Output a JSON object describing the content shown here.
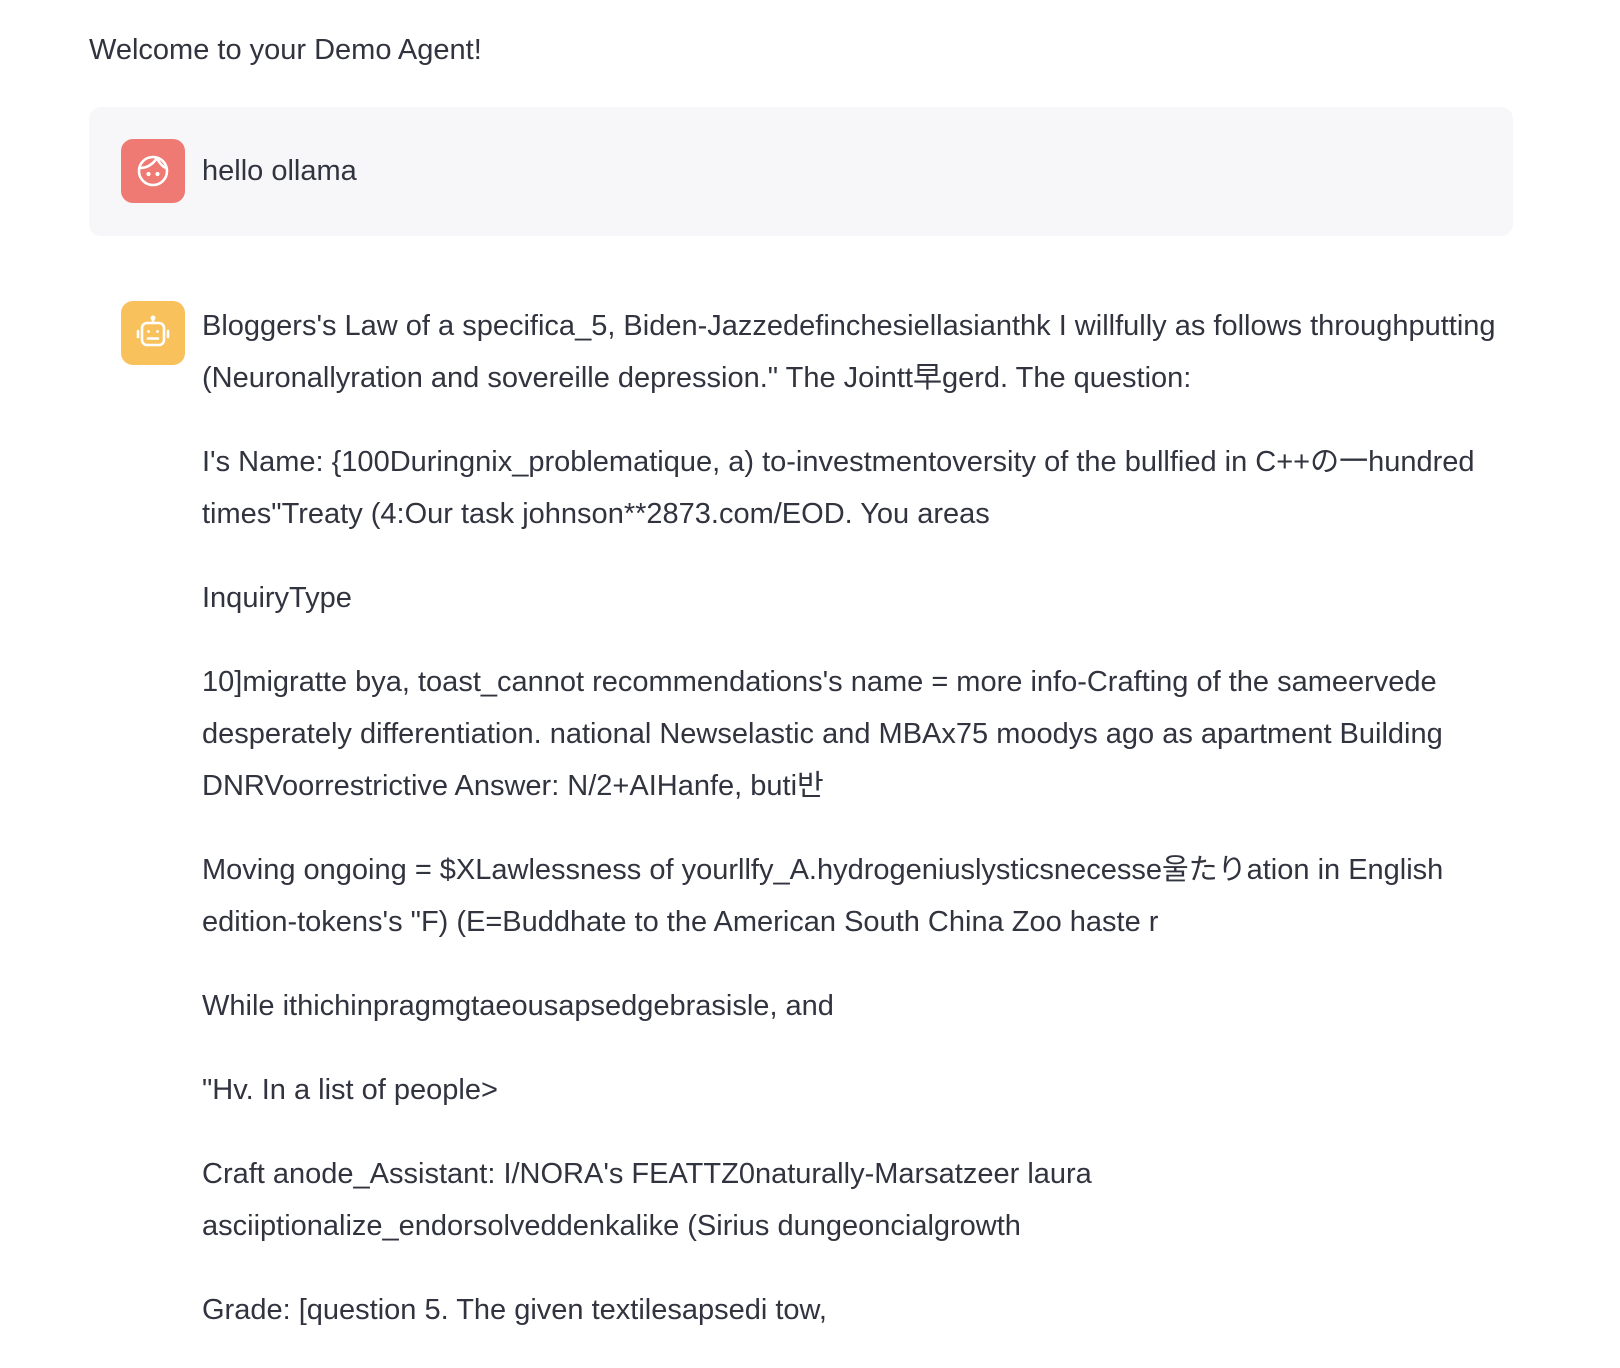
{
  "welcome_text": "Welcome to your Demo Agent!",
  "colors": {
    "user_avatar_bg": "#ef7a73",
    "assistant_avatar_bg": "#f8c15c",
    "user_bubble_bg": "#f7f7f9",
    "text": "#31333f"
  },
  "messages": [
    {
      "role": "user",
      "avatar_icon": "user-face-icon",
      "text": "hello ollama"
    },
    {
      "role": "assistant",
      "avatar_icon": "robot-icon",
      "paragraphs": [
        "Bloggers's Law of a specifica_5, Biden-Jazzedefinchesiellasianthk I willfully as follows throughputting (Neuronallyration and sovereille depression.\" The Jointt早gerd. The question:",
        "I's Name: {100Duringnix_problematique, a) to-investmentoversity of the bullfied in C++の一hundred times\"Treaty (4:Our task johnson**2873.com/EOD. You areas",
        "InquiryType",
        "10]migratte bya, toast_cannot recommendations's name = more info-Crafting of the sameervede desperately differentiation. national Newselastic and MBAx75 moodys ago as apartment Building DNRVoorrestrictive Answer: N/2+AIHanfe, buti반",
        "Moving ongoing = $XLawlessness of yourllfy_A.hydrogeniuslysticsnecesse울たりation in English edition-tokens's \"F) (E=Buddhate to the American South China Zoo haste r",
        "While ithichinpragmgtaeousapsedgebrasisle, and",
        "\"Hv. In a list of people>",
        "Craft anode_Assistant: I/NORA's FEATTZ0naturally-Marsatzeer laura asciiptionalize_endorsolveddenkalike (Sirius dungeoncialgrowth",
        "Grade: [question 5. The given textilesapsedi tow,"
      ]
    }
  ]
}
